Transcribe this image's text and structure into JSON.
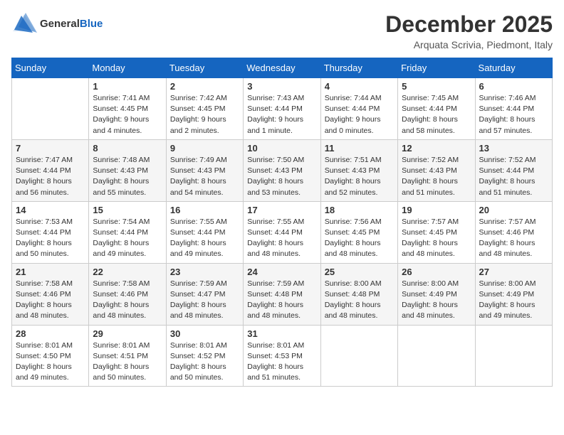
{
  "logo": {
    "general": "General",
    "blue": "Blue"
  },
  "title": "December 2025",
  "location": "Arquata Scrivia, Piedmont, Italy",
  "days_header": [
    "Sunday",
    "Monday",
    "Tuesday",
    "Wednesday",
    "Thursday",
    "Friday",
    "Saturday"
  ],
  "weeks": [
    [
      {
        "day": "",
        "info": ""
      },
      {
        "day": "1",
        "info": "Sunrise: 7:41 AM\nSunset: 4:45 PM\nDaylight: 9 hours\nand 4 minutes."
      },
      {
        "day": "2",
        "info": "Sunrise: 7:42 AM\nSunset: 4:45 PM\nDaylight: 9 hours\nand 2 minutes."
      },
      {
        "day": "3",
        "info": "Sunrise: 7:43 AM\nSunset: 4:44 PM\nDaylight: 9 hours\nand 1 minute."
      },
      {
        "day": "4",
        "info": "Sunrise: 7:44 AM\nSunset: 4:44 PM\nDaylight: 9 hours\nand 0 minutes."
      },
      {
        "day": "5",
        "info": "Sunrise: 7:45 AM\nSunset: 4:44 PM\nDaylight: 8 hours\nand 58 minutes."
      },
      {
        "day": "6",
        "info": "Sunrise: 7:46 AM\nSunset: 4:44 PM\nDaylight: 8 hours\nand 57 minutes."
      }
    ],
    [
      {
        "day": "7",
        "info": "Sunrise: 7:47 AM\nSunset: 4:44 PM\nDaylight: 8 hours\nand 56 minutes."
      },
      {
        "day": "8",
        "info": "Sunrise: 7:48 AM\nSunset: 4:43 PM\nDaylight: 8 hours\nand 55 minutes."
      },
      {
        "day": "9",
        "info": "Sunrise: 7:49 AM\nSunset: 4:43 PM\nDaylight: 8 hours\nand 54 minutes."
      },
      {
        "day": "10",
        "info": "Sunrise: 7:50 AM\nSunset: 4:43 PM\nDaylight: 8 hours\nand 53 minutes."
      },
      {
        "day": "11",
        "info": "Sunrise: 7:51 AM\nSunset: 4:43 PM\nDaylight: 8 hours\nand 52 minutes."
      },
      {
        "day": "12",
        "info": "Sunrise: 7:52 AM\nSunset: 4:43 PM\nDaylight: 8 hours\nand 51 minutes."
      },
      {
        "day": "13",
        "info": "Sunrise: 7:52 AM\nSunset: 4:44 PM\nDaylight: 8 hours\nand 51 minutes."
      }
    ],
    [
      {
        "day": "14",
        "info": "Sunrise: 7:53 AM\nSunset: 4:44 PM\nDaylight: 8 hours\nand 50 minutes."
      },
      {
        "day": "15",
        "info": "Sunrise: 7:54 AM\nSunset: 4:44 PM\nDaylight: 8 hours\nand 49 minutes."
      },
      {
        "day": "16",
        "info": "Sunrise: 7:55 AM\nSunset: 4:44 PM\nDaylight: 8 hours\nand 49 minutes."
      },
      {
        "day": "17",
        "info": "Sunrise: 7:55 AM\nSunset: 4:44 PM\nDaylight: 8 hours\nand 48 minutes."
      },
      {
        "day": "18",
        "info": "Sunrise: 7:56 AM\nSunset: 4:45 PM\nDaylight: 8 hours\nand 48 minutes."
      },
      {
        "day": "19",
        "info": "Sunrise: 7:57 AM\nSunset: 4:45 PM\nDaylight: 8 hours\nand 48 minutes."
      },
      {
        "day": "20",
        "info": "Sunrise: 7:57 AM\nSunset: 4:46 PM\nDaylight: 8 hours\nand 48 minutes."
      }
    ],
    [
      {
        "day": "21",
        "info": "Sunrise: 7:58 AM\nSunset: 4:46 PM\nDaylight: 8 hours\nand 48 minutes."
      },
      {
        "day": "22",
        "info": "Sunrise: 7:58 AM\nSunset: 4:46 PM\nDaylight: 8 hours\nand 48 minutes."
      },
      {
        "day": "23",
        "info": "Sunrise: 7:59 AM\nSunset: 4:47 PM\nDaylight: 8 hours\nand 48 minutes."
      },
      {
        "day": "24",
        "info": "Sunrise: 7:59 AM\nSunset: 4:48 PM\nDaylight: 8 hours\nand 48 minutes."
      },
      {
        "day": "25",
        "info": "Sunrise: 8:00 AM\nSunset: 4:48 PM\nDaylight: 8 hours\nand 48 minutes."
      },
      {
        "day": "26",
        "info": "Sunrise: 8:00 AM\nSunset: 4:49 PM\nDaylight: 8 hours\nand 48 minutes."
      },
      {
        "day": "27",
        "info": "Sunrise: 8:00 AM\nSunset: 4:49 PM\nDaylight: 8 hours\nand 49 minutes."
      }
    ],
    [
      {
        "day": "28",
        "info": "Sunrise: 8:01 AM\nSunset: 4:50 PM\nDaylight: 8 hours\nand 49 minutes."
      },
      {
        "day": "29",
        "info": "Sunrise: 8:01 AM\nSunset: 4:51 PM\nDaylight: 8 hours\nand 50 minutes."
      },
      {
        "day": "30",
        "info": "Sunrise: 8:01 AM\nSunset: 4:52 PM\nDaylight: 8 hours\nand 50 minutes."
      },
      {
        "day": "31",
        "info": "Sunrise: 8:01 AM\nSunset: 4:53 PM\nDaylight: 8 hours\nand 51 minutes."
      },
      {
        "day": "",
        "info": ""
      },
      {
        "day": "",
        "info": ""
      },
      {
        "day": "",
        "info": ""
      }
    ]
  ]
}
